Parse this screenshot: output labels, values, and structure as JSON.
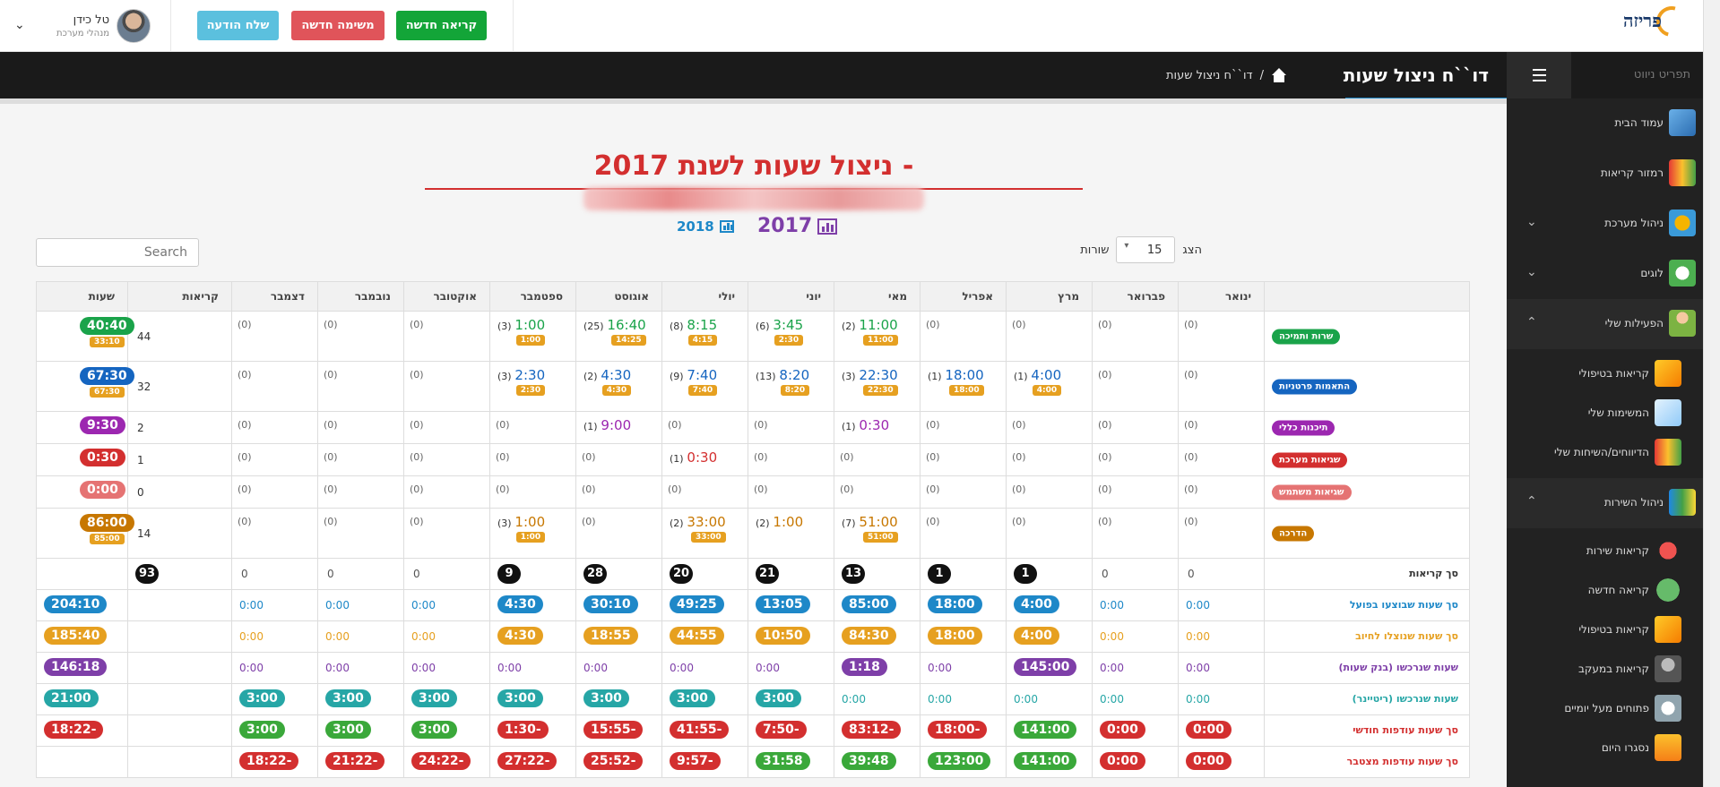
{
  "header": {
    "buttons": {
      "new_call": "קריאה חדשה",
      "new_task": "משימה חדשה",
      "send_message": "שלח הודעה"
    },
    "user": {
      "name": "טל כידן",
      "role": "מנהלי מערכת"
    },
    "logo": {
      "name": "פריזה"
    }
  },
  "breadcrumb": {
    "page_title": "דו``ח ניצול שעות",
    "current": "דו``ח ניצול שעות"
  },
  "sidebar": {
    "nav_label": "תפריט ניווט",
    "items": [
      {
        "label": "עמוד הבית"
      },
      {
        "label": "רמזור קריאות"
      },
      {
        "label": "ניהול מערכת"
      },
      {
        "label": "לוגים"
      },
      {
        "label": "הפעילות שלי"
      },
      {
        "label": "קריאות בטיפולי"
      },
      {
        "label": "המשימות שלי"
      },
      {
        "label": "הדיווחים/השיחות שלי"
      },
      {
        "label": "ניהול השירות"
      },
      {
        "label": "קריאות שירות"
      },
      {
        "label": "קריאה חדשה"
      },
      {
        "label": "קריאות בטיפולי"
      },
      {
        "label": "קריאות במעקב"
      },
      {
        "label": "פתוחים מעל יומיים"
      },
      {
        "label": "נסגרו היום"
      }
    ]
  },
  "report": {
    "title": "- ניצול שעות לשנת 2017",
    "year_current": "2017",
    "year_next": "2018",
    "show_label": "הצג",
    "rows_label": "שורות",
    "page_length": "15",
    "search_placeholder": "Search"
  },
  "table": {
    "headers": [
      "ינואר",
      "פברואר",
      "מרץ",
      "אפריל",
      "מאי",
      "יוני",
      "יולי",
      "אוגוסט",
      "ספטמבר",
      "אוקטובר",
      "נובמבר",
      "דצמבר",
      "קריאות",
      "שעות"
    ],
    "zero_label": "(0)",
    "categories": [
      {
        "label": "שרות ותמיכה",
        "color": "#1aa34a"
      },
      {
        "label": "התאמות פרטניות",
        "color": "#1565c0"
      },
      {
        "label": "תיכנות כללי",
        "color": "#9c27b0"
      },
      {
        "label": "שגיאות מערכת",
        "color": "#d32f2f"
      },
      {
        "label": "שגיאות משתמש",
        "color": "#e57373"
      },
      {
        "label": "הדרכה",
        "color": "#c77700"
      }
    ],
    "rows": [
      {
        "cells": [
          null,
          null,
          null,
          null,
          {
            "c": "(2)",
            "m": "11:00",
            "s": "11:00"
          },
          {
            "c": "(6)",
            "m": "3:45",
            "s": "2:30"
          },
          {
            "c": "(8)",
            "m": "8:15",
            "s": "4:15"
          },
          {
            "c": "(25)",
            "m": "16:40",
            "s": "14:25"
          },
          {
            "c": "(3)",
            "m": "1:00",
            "s": "1:00"
          },
          null,
          null,
          null
        ],
        "calls": "44",
        "hours": "40:40",
        "hours_sub": "33:10"
      },
      {
        "cells": [
          null,
          null,
          {
            "c": "(1)",
            "m": "4:00",
            "s": "4:00"
          },
          {
            "c": "(1)",
            "m": "18:00",
            "s": "18:00"
          },
          {
            "c": "(3)",
            "m": "22:30",
            "s": "22:30"
          },
          {
            "c": "(13)",
            "m": "8:20",
            "s": "8:20"
          },
          {
            "c": "(9)",
            "m": "7:40",
            "s": "7:40"
          },
          {
            "c": "(2)",
            "m": "4:30",
            "s": "4:30"
          },
          {
            "c": "(3)",
            "m": "2:30",
            "s": "2:30"
          },
          null,
          null,
          null
        ],
        "calls": "32",
        "hours": "67:30",
        "hours_sub": "67:30"
      },
      {
        "cells": [
          null,
          null,
          null,
          null,
          {
            "c": "(1)",
            "m": "0:30"
          },
          null,
          null,
          {
            "c": "(1)",
            "m": "9:00"
          },
          null,
          null,
          null,
          null
        ],
        "calls": "2",
        "hours": "9:30"
      },
      {
        "cells": [
          null,
          null,
          null,
          null,
          null,
          null,
          {
            "c": "(1)",
            "m": "0:30"
          },
          null,
          null,
          null,
          null,
          null
        ],
        "calls": "1",
        "hours": "0:30"
      },
      {
        "cells": [
          null,
          null,
          null,
          null,
          null,
          null,
          null,
          null,
          null,
          null,
          null,
          null
        ],
        "calls": "0",
        "hours": "0:00"
      },
      {
        "cells": [
          null,
          null,
          null,
          null,
          {
            "c": "(7)",
            "m": "51:00",
            "s": "51:00"
          },
          {
            "c": "(2)",
            "m": "1:00"
          },
          {
            "c": "(2)",
            "m": "33:00",
            "s": "33:00"
          },
          null,
          {
            "c": "(3)",
            "m": "1:00",
            "s": "1:00"
          },
          null,
          null,
          null
        ],
        "calls": "14",
        "hours": "86:00",
        "hours_sub": "85:00"
      }
    ],
    "summary": [
      {
        "label": "סך קריאות",
        "color": "#333",
        "values": [
          "0",
          "0",
          "1",
          "1",
          "13",
          "21",
          "20",
          "28",
          "9",
          "0",
          "0",
          "0",
          "93",
          ""
        ]
      },
      {
        "label": "סך שעות שבוצעו בפועל",
        "color": "#1e88c8",
        "values": [
          "0:00",
          "0:00",
          "4:00",
          "18:00",
          "85:00",
          "13:05",
          "49:25",
          "30:10",
          "4:30",
          "0:00",
          "0:00",
          "0:00",
          "",
          "204:10"
        ]
      },
      {
        "label": "סך שעות שנוצלו לחיוב",
        "color": "#e6a020",
        "values": [
          "0:00",
          "0:00",
          "4:00",
          "18:00",
          "84:30",
          "10:50",
          "44:55",
          "18:55",
          "4:30",
          "0:00",
          "0:00",
          "0:00",
          "",
          "185:40"
        ]
      },
      {
        "label": "שעות שנרכשו (בנק שעות)",
        "color": "#7e3fa8",
        "values": [
          "0:00",
          "0:00",
          "145:00",
          "0:00",
          "1:18",
          "0:00",
          "0:00",
          "0:00",
          "0:00",
          "0:00",
          "0:00",
          "0:00",
          "",
          "146:18"
        ]
      },
      {
        "label": "שעות שנרכשו (ריטיינר)",
        "color": "#26a6a6",
        "values": [
          "0:00",
          "0:00",
          "0:00",
          "0:00",
          "0:00",
          "3:00",
          "3:00",
          "3:00",
          "3:00",
          "3:00",
          "3:00",
          "3:00",
          "",
          "21:00"
        ]
      },
      {
        "label": "סך שעות עודפות חודשי",
        "color": "#d32f2f",
        "values": [
          "0:00",
          "0:00",
          "141:00",
          "-18:00",
          "-83:12",
          "-7:50",
          "-41:55",
          "-15:55",
          "-1:30",
          "3:00",
          "3:00",
          "3:00",
          "",
          "-18:22"
        ]
      },
      {
        "label": "סך שעות עודפות מצטבר",
        "color": "#d32f2f",
        "values": [
          "0:00",
          "0:00",
          "141:00",
          "123:00",
          "39:48",
          "31:58",
          "-9:57",
          "-25:52",
          "-27:22",
          "-24:22",
          "-21:22",
          "-18:22",
          "",
          ""
        ]
      }
    ]
  },
  "colors": {
    "green": "#3aa83a",
    "red": "#d32f2f",
    "blue": "#1e88c8",
    "orange": "#e6a020",
    "purple": "#7e3fa8",
    "teal": "#26a6a6"
  }
}
